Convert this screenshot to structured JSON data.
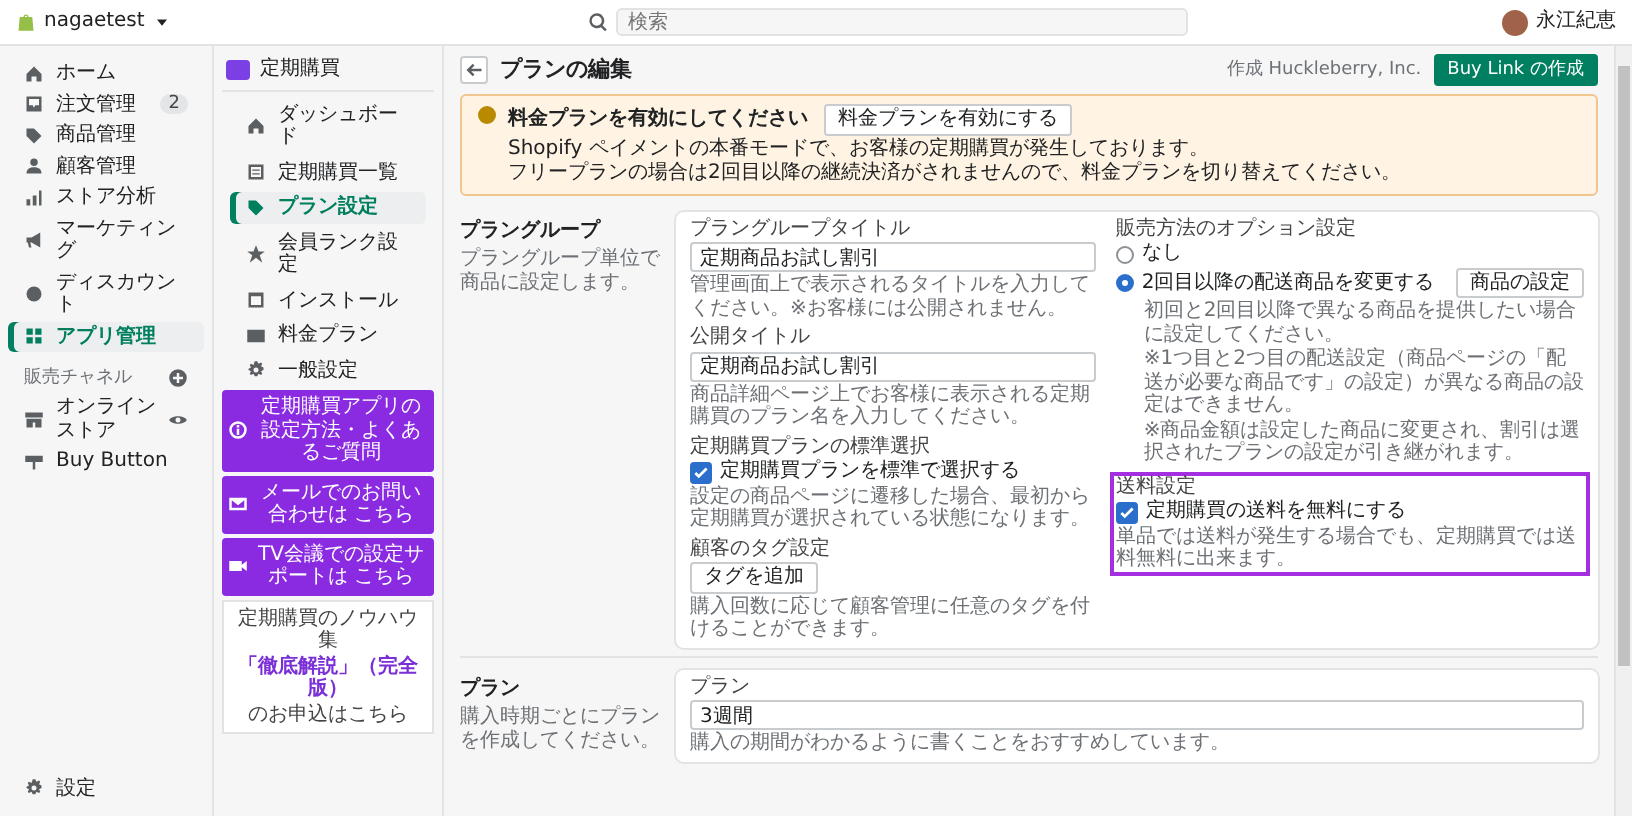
{
  "topbar": {
    "store": "nagaetest",
    "search": {
      "placeholder": "検索"
    },
    "user": "永江紀恵"
  },
  "nav": {
    "items": [
      {
        "label": "ホーム",
        "selected": false
      },
      {
        "label": "注文管理",
        "badge": "2",
        "selected": false
      },
      {
        "label": "商品管理",
        "selected": false
      },
      {
        "label": "顧客管理",
        "selected": false
      },
      {
        "label": "ストア分析",
        "selected": false
      },
      {
        "label": "マーケティング",
        "selected": false
      },
      {
        "label": "ディスカウント",
        "selected": false
      },
      {
        "label": "アプリ管理",
        "selected": true
      }
    ],
    "channels_heading": "販売チャネル",
    "channels": [
      {
        "label": "オンラインストア"
      },
      {
        "label": "Buy Button"
      }
    ],
    "settings": "設定"
  },
  "app": {
    "title": "定期購買",
    "credit": "作成 Huckleberry, Inc.",
    "nav": [
      {
        "label": "ダッシュボード",
        "selected": false
      },
      {
        "label": "定期購買一覧",
        "selected": false
      },
      {
        "label": "プラン設定",
        "selected": true
      },
      {
        "label": "会員ランク設定",
        "selected": false
      },
      {
        "label": "インストール",
        "selected": false
      },
      {
        "label": "料金プラン",
        "selected": false
      },
      {
        "label": "一般設定",
        "selected": false
      }
    ],
    "help_buttons": [
      "定期購買アプリの設定方法・よくあるご質問",
      "メールでのお問い合わせは こちら",
      "TV会議での設定サポートは こちら"
    ],
    "promo": {
      "heading": "定期購買のノウハウ集",
      "title": "「徹底解説」（完全版）",
      "footer": "のお申込はこちら"
    }
  },
  "page": {
    "title": "プランの編集",
    "primary_button": "Buy Link の作成",
    "banner": {
      "title": "料金プランを有効にしてください",
      "lines": [
        "Shopify ペイメントの本番モードで、お客様の定期購買が発生しております。",
        "フリープランの場合は2回目以降の継続決済がされませんので、料金プランを切り替えてください。"
      ],
      "button": "料金プランを有効にする"
    },
    "sections": [
      {
        "title": "プラングループ",
        "description": "プラングループ単位で商品に設定します。",
        "columns": [
          [
            {
              "label": "プラングループタイトル",
              "highlighted": false,
              "controls": [
                {
                  "kind": "field",
                  "value": "定期商品お試し割引"
                },
                {
                  "kind": "help",
                  "text": "管理画面上で表示されるタイトルを入力してください。※お客様には公開されません。"
                }
              ]
            },
            {
              "label": "公開タイトル",
              "highlighted": false,
              "controls": [
                {
                  "kind": "field",
                  "value": "定期商品お試し割引"
                },
                {
                  "kind": "help",
                  "text": "商品詳細ページ上でお客様に表示される定期購買のプラン名を入力してください。"
                }
              ]
            },
            {
              "label": "定期購買プランの標準選択",
              "highlighted": false,
              "controls": [
                {
                  "kind": "checkbox",
                  "label": "定期購買プランを標準で選択する",
                  "checked": true
                },
                {
                  "kind": "help",
                  "text": "設定の商品ページに遷移した場合、最初から定期購買が選択されている状態になります。"
                }
              ]
            },
            {
              "label": "顧客のタグ設定",
              "highlighted": false,
              "controls": [
                {
                  "kind": "button",
                  "label": "タグを追加"
                },
                {
                  "kind": "help",
                  "text": "購入回数に応じて顧客管理に任意のタグを付けることができます。"
                }
              ]
            }
          ],
          [
            {
              "label": "販売方法のオプション設定",
              "highlighted": false,
              "controls": [
                {
                  "kind": "radio",
                  "label": "なし",
                  "selected": false
                },
                {
                  "kind": "radio",
                  "label": "2回目以降の配送商品を変更する",
                  "selected": true,
                  "button": "商品の設定"
                },
                {
                  "kind": "note",
                  "text": "初回と2回目以降で異なる商品を提供したい場合に設定してください。"
                },
                {
                  "kind": "note",
                  "text": "※1つ目と2つ目の配送設定（商品ページの「配送が必要な商品です」の設定）が異なる商品の設定はできません。"
                },
                {
                  "kind": "note",
                  "text": "※商品金額は設定した商品に変更され、割引は選択されたプランの設定が引き継がれます。"
                }
              ]
            },
            {
              "label": "送料設定",
              "highlighted": true,
              "controls": [
                {
                  "kind": "checkbox",
                  "label": "定期購買の送料を無料にする",
                  "checked": true
                },
                {
                  "kind": "help",
                  "text": "単品では送料が発生する場合でも、定期購買では送料無料に出来ます。"
                }
              ]
            }
          ]
        ]
      },
      {
        "title": "プラン",
        "description": "購入時期ごとにプランを作成してください。",
        "columns": [
          [
            {
              "label": "プラン",
              "highlighted": false,
              "controls": [
                {
                  "kind": "field",
                  "value": "3週間"
                },
                {
                  "kind": "help",
                  "text": "購入の期間がわかるように書くことをおすすめしています。"
                }
              ]
            }
          ]
        ]
      }
    ]
  }
}
